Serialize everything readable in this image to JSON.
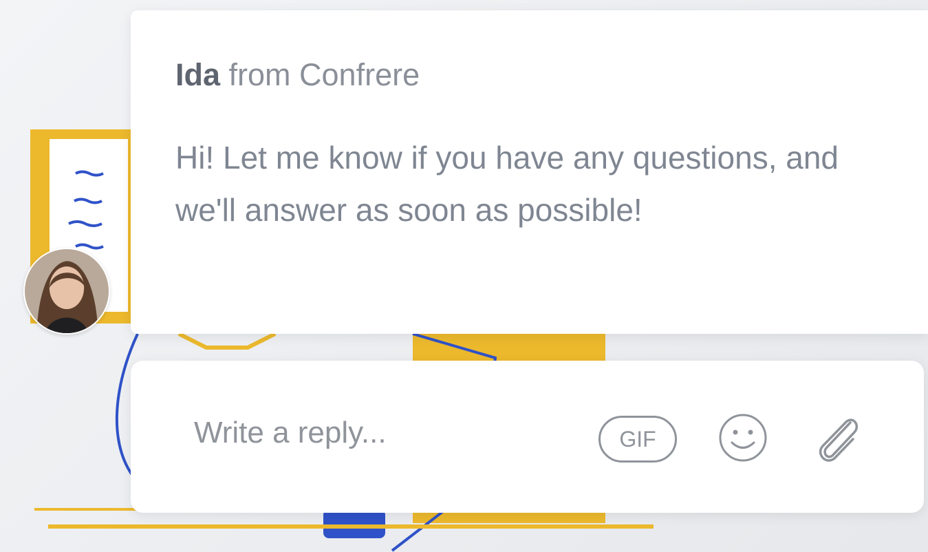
{
  "message": {
    "sender_name": "Ida",
    "sender_suffix": " from Confrere",
    "body": "Hi! Let me know if you have any questions, and we'll answer as soon as possible!"
  },
  "reply": {
    "placeholder": "Write a reply...",
    "gif_label": "GIF"
  },
  "icons": {
    "emoji": "smiley-icon",
    "attach": "paperclip-icon",
    "avatar": "avatar-photo"
  },
  "colors": {
    "illustration_yellow": "#ecb92d",
    "illustration_blue": "#2f52c8",
    "text_muted": "#7f8692"
  }
}
